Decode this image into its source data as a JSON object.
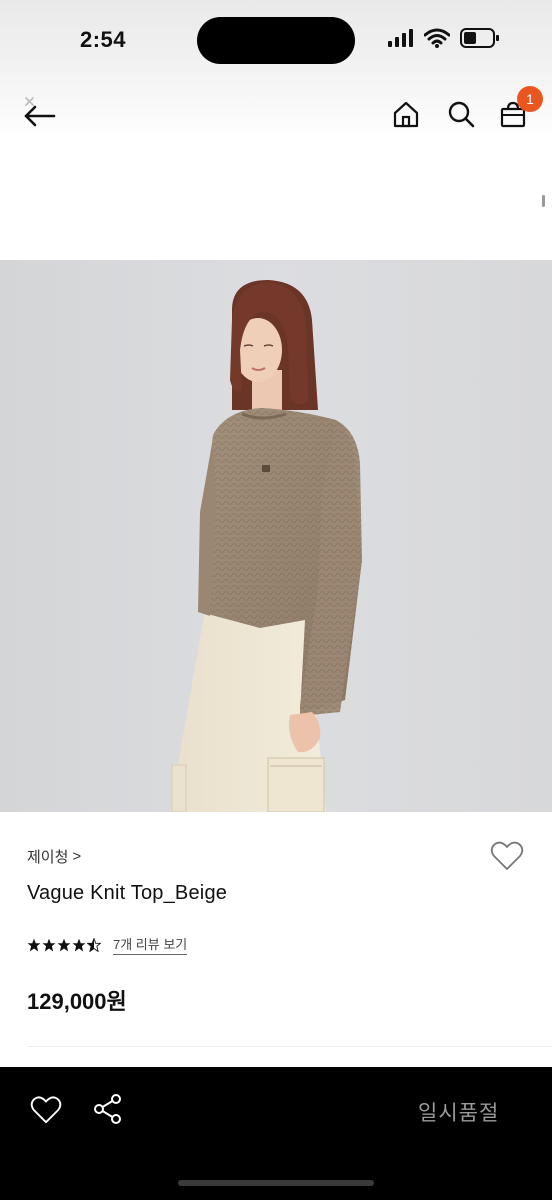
{
  "status_bar": {
    "time": "2:54",
    "icons": [
      "cellular-signal-icon",
      "wifi-icon",
      "battery-icon"
    ]
  },
  "header": {
    "icons": [
      "back-arrow-icon",
      "home-icon",
      "search-icon",
      "cart-icon"
    ],
    "cart_badge": "1",
    "badge_color": "#e9561f"
  },
  "product": {
    "brand": "제이청",
    "brand_chevron": ">",
    "title": "Vague Knit Top_Beige",
    "rating": 4.5,
    "review_link": "7개 리뷰 보기",
    "price": "129,000원"
  },
  "bottom_bar": {
    "icons": [
      "heart-icon",
      "share-icon"
    ],
    "status_label": "일시품절"
  }
}
